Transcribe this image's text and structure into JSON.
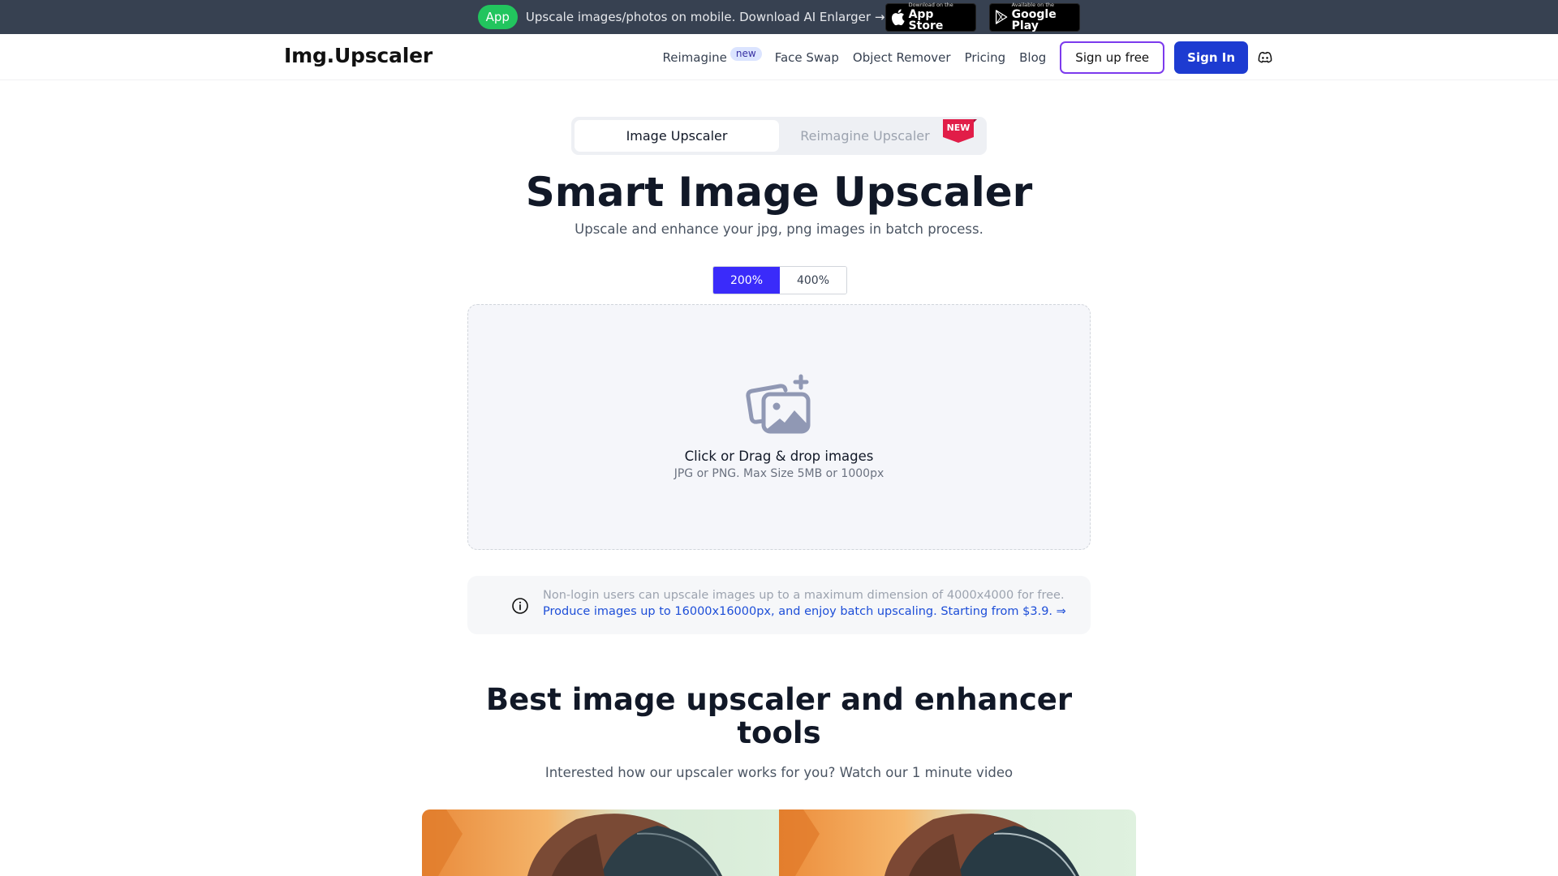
{
  "banner": {
    "app_pill": "App",
    "text": "Upscale images/photos on mobile. Download AI Enlarger →",
    "app_store": {
      "small": "Download on the",
      "big": "App Store"
    },
    "google_play": {
      "small": "Available on the",
      "big": "Google Play"
    }
  },
  "nav": {
    "logo": "Img.Upscaler",
    "links": [
      {
        "label": "Reimagine",
        "badge": "new"
      },
      {
        "label": "Face Swap"
      },
      {
        "label": "Object Remover"
      },
      {
        "label": "Pricing"
      },
      {
        "label": "Blog"
      }
    ],
    "signup_label": "Sign up free",
    "signin_label": "Sign In",
    "discord_icon": "discord-icon"
  },
  "mode_tabs": {
    "items": [
      {
        "label": "Image Upscaler",
        "active": true
      },
      {
        "label": "Reimagine Upscaler",
        "active": false,
        "ribbon": "NEW"
      }
    ]
  },
  "hero": {
    "title": "Smart Image Upscaler",
    "subtitle": "Upscale and enhance your jpg, png images in batch process."
  },
  "scale": {
    "options": [
      "200%",
      "400%"
    ],
    "selected": "200%"
  },
  "dropzone": {
    "icon": "add-images-icon",
    "title": "Click or Drag & drop images",
    "subtitle": "JPG or PNG. Max Size 5MB or 1000px"
  },
  "info": {
    "icon": "info-icon",
    "line1": "Non-login users can upscale images up to a maximum dimension of 4000x4000 for free.",
    "line2": "Produce images up to 16000x16000px, and enjoy batch upscaling. Starting from $3.9. ⇒"
  },
  "section": {
    "title": "Best image upscaler and enhancer tools",
    "subtitle": "Interested how our upscaler works for you? Watch our 1 minute video"
  },
  "colors": {
    "banner_bg": "#374151",
    "app_pill": "#22c55e",
    "primary": "#1d3bd1",
    "toggle_active": "#3a2bfa",
    "link": "#1d4ed8",
    "ribbon": "#e11d48"
  }
}
